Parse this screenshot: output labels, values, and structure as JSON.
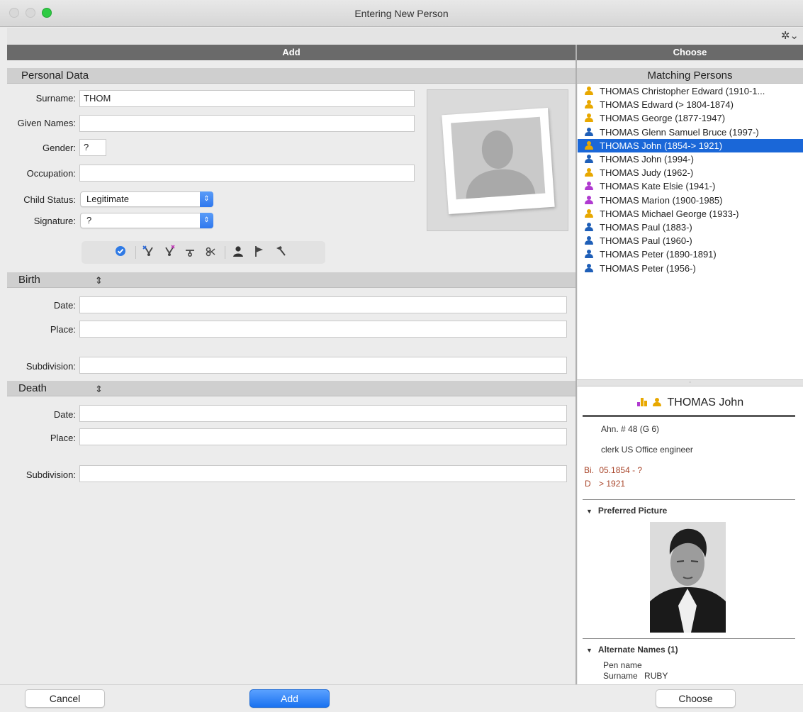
{
  "window": {
    "title": "Entering New Person"
  },
  "columns": {
    "add": "Add",
    "choose": "Choose"
  },
  "personal": {
    "header": "Personal Data",
    "surname_label": "Surname:",
    "surname_value": "THOM",
    "given_label": "Given Names:",
    "given_value": "",
    "gender_label": "Gender:",
    "gender_value": "?",
    "occupation_label": "Occupation:",
    "occupation_value": "",
    "child_status_label": "Child Status:",
    "child_status_value": "Legitimate",
    "signature_label": "Signature:",
    "signature_value": "?"
  },
  "birth": {
    "header": "Birth",
    "date_label": "Date:",
    "place_label": "Place:",
    "subdivision_label": "Subdivision:"
  },
  "death": {
    "header": "Death",
    "date_label": "Date:",
    "place_label": "Place:",
    "subdivision_label": "Subdivision:"
  },
  "matching": {
    "header": "Matching Persons",
    "items": [
      {
        "label": "THOMAS Christopher Edward (1910-1...",
        "color": "#e8a800"
      },
      {
        "label": "THOMAS Edward (> 1804-1874)",
        "color": "#e8a800"
      },
      {
        "label": "THOMAS George (1877-1947)",
        "color": "#e8a800"
      },
      {
        "label": "THOMAS Glenn Samuel Bruce (1997-)",
        "color": "#1f5fb8"
      },
      {
        "label": "THOMAS John (1854-> 1921)",
        "color": "#e8a800",
        "selected": true
      },
      {
        "label": "THOMAS John (1994-)",
        "color": "#1f5fb8"
      },
      {
        "label": "THOMAS Judy (1962-)",
        "color": "#e8a800"
      },
      {
        "label": "THOMAS Kate Elsie (1941-)",
        "color": "#b03ad0"
      },
      {
        "label": "THOMAS Marion (1900-1985)",
        "color": "#b03ad0"
      },
      {
        "label": "THOMAS Michael George (1933-)",
        "color": "#e8a800"
      },
      {
        "label": "THOMAS Paul (1883-)",
        "color": "#1f5fb8"
      },
      {
        "label": "THOMAS Paul (1960-)",
        "color": "#1f5fb8"
      },
      {
        "label": "THOMAS Peter (1890-1891)",
        "color": "#1f5fb8"
      },
      {
        "label": "THOMAS Peter (1956-)",
        "color": "#1f5fb8"
      }
    ]
  },
  "detail": {
    "name": "THOMAS John",
    "ahn": "Ahn. # 48 (G 6)",
    "occupation": "clerk US Office engineer",
    "birth_prefix": "Bi.",
    "birth": "05.1854 - ?",
    "death_prefix": "D",
    "death": "> 1921",
    "preferred_picture": "Preferred Picture",
    "alternate_names": "Alternate Names (1)",
    "alt_type": "Pen name",
    "alt_surname_label": "Surname",
    "alt_surname_value": "RUBY"
  },
  "buttons": {
    "cancel": "Cancel",
    "add": "Add",
    "choose": "Choose"
  },
  "colors": {
    "accent": "#1a67d8",
    "event_red": "#a9462b"
  }
}
